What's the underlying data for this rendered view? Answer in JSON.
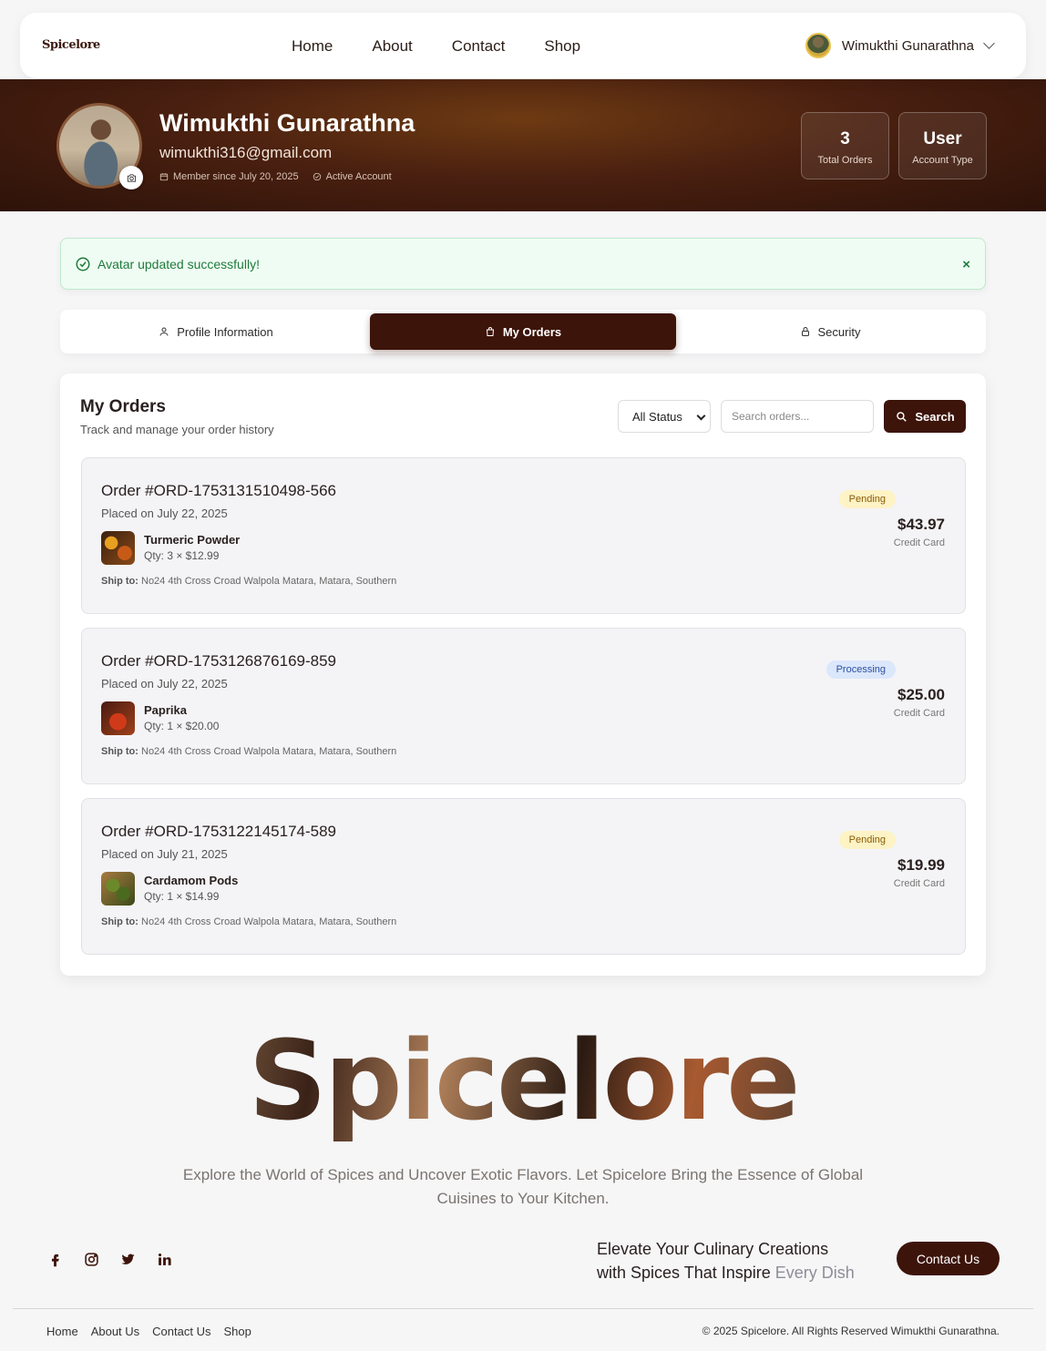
{
  "nav": {
    "logo": "Spicelore",
    "links": [
      "Home",
      "About",
      "Contact",
      "Shop"
    ],
    "user_name": "Wimukthi Gunarathna"
  },
  "hero": {
    "name": "Wimukthi Gunarathna",
    "email": "wimukthi316@gmail.com",
    "member_since": "Member since July 20, 2025",
    "account_status": "Active Account",
    "stats": [
      {
        "value": "3",
        "label": "Total Orders"
      },
      {
        "value": "User",
        "label": "Account Type"
      }
    ]
  },
  "alert": {
    "message": "Avatar updated successfully!",
    "close": "×"
  },
  "tabs": [
    {
      "label": "Profile Information",
      "icon": "user-icon",
      "active": false
    },
    {
      "label": "My Orders",
      "icon": "bag-icon",
      "active": true
    },
    {
      "label": "Security",
      "icon": "lock-icon",
      "active": false
    }
  ],
  "orders_panel": {
    "title": "My Orders",
    "subtitle": "Track and manage your order history",
    "status_filter": "All Status",
    "search_placeholder": "Search orders...",
    "search_button": "Search"
  },
  "orders": [
    {
      "id": "Order #ORD-1753131510498-566",
      "date": "Placed on July 22, 2025",
      "item": "Turmeric Powder",
      "qty": "Qty: 3 × $12.99",
      "ship_label": "Ship to:",
      "ship_address": "No24 4th Cross Croad Walpola Matara, Matara, Southern",
      "status": "Pending",
      "total": "$43.97",
      "payment": "Credit Card"
    },
    {
      "id": "Order #ORD-1753126876169-859",
      "date": "Placed on July 22, 2025",
      "item": "Paprika",
      "qty": "Qty: 1 × $20.00",
      "ship_label": "Ship to:",
      "ship_address": "No24 4th Cross Croad Walpola Matara, Matara, Southern",
      "status": "Processing",
      "total": "$25.00",
      "payment": "Credit Card"
    },
    {
      "id": "Order #ORD-1753122145174-589",
      "date": "Placed on July 21, 2025",
      "item": "Cardamom Pods",
      "qty": "Qty: 1 × $14.99",
      "ship_label": "Ship to:",
      "ship_address": "No24 4th Cross Croad Walpola Matara, Matara, Southern",
      "status": "Pending",
      "total": "$19.99",
      "payment": "Credit Card"
    }
  ],
  "footer": {
    "brand": "Spicelore",
    "tagline": "Explore the World of Spices and Uncover Exotic Flavors. Let Spicelore Bring the Essence of Global Cuisines to Your Kitchen.",
    "socials": [
      "facebook-icon",
      "instagram-icon",
      "twitter-icon",
      "linkedin-icon"
    ],
    "elevate_line1": "Elevate Your Culinary Creations",
    "elevate_line2_a": "with Spices That Inspire",
    "elevate_line2_b": "Every Dish",
    "contact_button": "Contact Us",
    "links": [
      "Home",
      "About Us",
      "Contact Us",
      "Shop"
    ],
    "copyright": "© 2025 Spicelore. All Rights Reserved Wimukthi Gunarathna."
  },
  "colors": {
    "primary": "#3d140a",
    "success_bg": "#effcf3",
    "success_text": "#1f7a3c",
    "pending_bg": "#fdf3c5",
    "processing_bg": "#dbe7fb"
  }
}
